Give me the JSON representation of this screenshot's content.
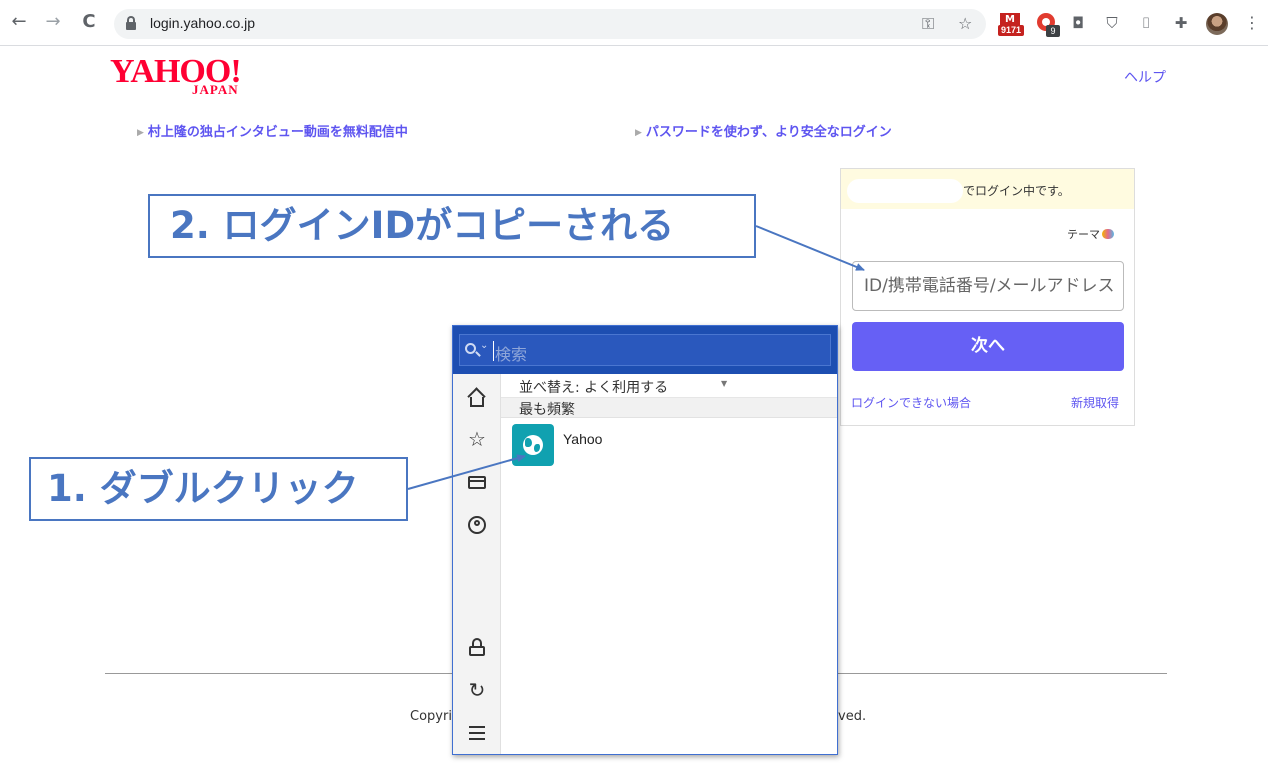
{
  "browser": {
    "url": "login.yahoo.co.jp",
    "back_icon": "←",
    "forward_icon": "→",
    "reload_icon": "C",
    "key_icon": "⚿",
    "star_icon": "☆",
    "mail_ext_letter": "M",
    "mail_badge": "9171",
    "red_ext_badge": "9",
    "camera_icon": "◘",
    "shield_icon": "⛉",
    "mouse_icon": "⌷",
    "puzzle_icon": "✚",
    "menu_icon": "⋮"
  },
  "page": {
    "logo_main": "YAHOO!",
    "logo_sub": "JAPAN",
    "help": "ヘルプ",
    "promo_left": "村上隆の独占インタビュー動画を無料配信中",
    "promo_right": "パスワードを使わず、より安全なログイン",
    "promo_marker": "▶",
    "login": {
      "status": "でログイン中です。",
      "theme": "テーマ",
      "id_placeholder": "ID/携帯電話番号/メールアドレス",
      "next_button": "次へ",
      "cant_login": "ログインできない場合",
      "register": "新規取得"
    },
    "footer_left": "Copyri",
    "footer_right": "ved."
  },
  "password_manager": {
    "search_placeholder": "検索",
    "search_caret": "⌄",
    "sort_label": "並べ替え: よく利用する",
    "sort_arrow": "▼",
    "group_label": "最も頻繁",
    "items": [
      {
        "name": "Yahoo"
      }
    ],
    "sync_icon": "↻"
  },
  "callouts": {
    "step2": "2. ログインIDがコピーされる",
    "step1": "1. ダブルクリック"
  },
  "colors": {
    "yahoo_red": "#ff0033",
    "link_purple": "#5e55f0",
    "button_purple": "#6660f5",
    "pm_header_blue": "#1d4eb1",
    "item_teal": "#10a1b0",
    "callout_blue": "#4a76c1"
  }
}
